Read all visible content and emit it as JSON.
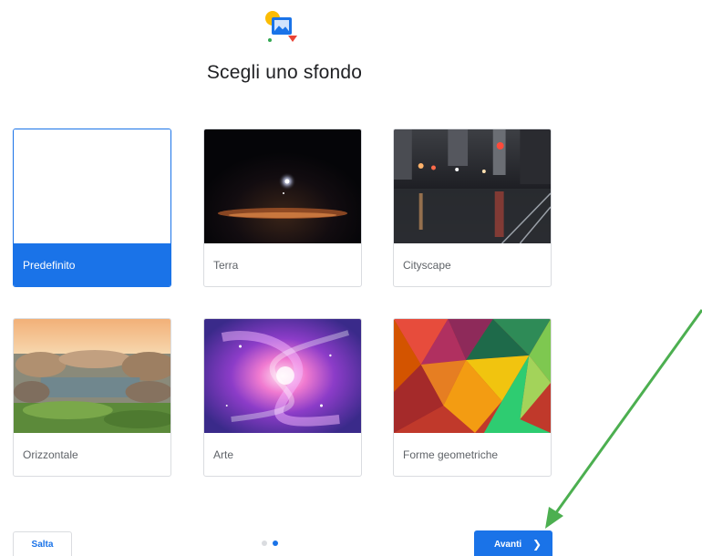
{
  "header": {
    "title": "Scegli uno sfondo"
  },
  "wallpapers": [
    {
      "label": "Predefinito",
      "selected": true
    },
    {
      "label": "Terra",
      "selected": false
    },
    {
      "label": "Cityscape",
      "selected": false
    },
    {
      "label": "Orizzontale",
      "selected": false
    },
    {
      "label": "Arte",
      "selected": false
    },
    {
      "label": "Forme geometriche",
      "selected": false
    }
  ],
  "footer": {
    "skip_label": "Salta",
    "next_label": "Avanti",
    "next_icon": "chevron-right-icon",
    "pagination": {
      "total": 2,
      "current": 2
    }
  },
  "colors": {
    "accent": "#1a73e8",
    "annotation_arrow": "#4caf50"
  }
}
